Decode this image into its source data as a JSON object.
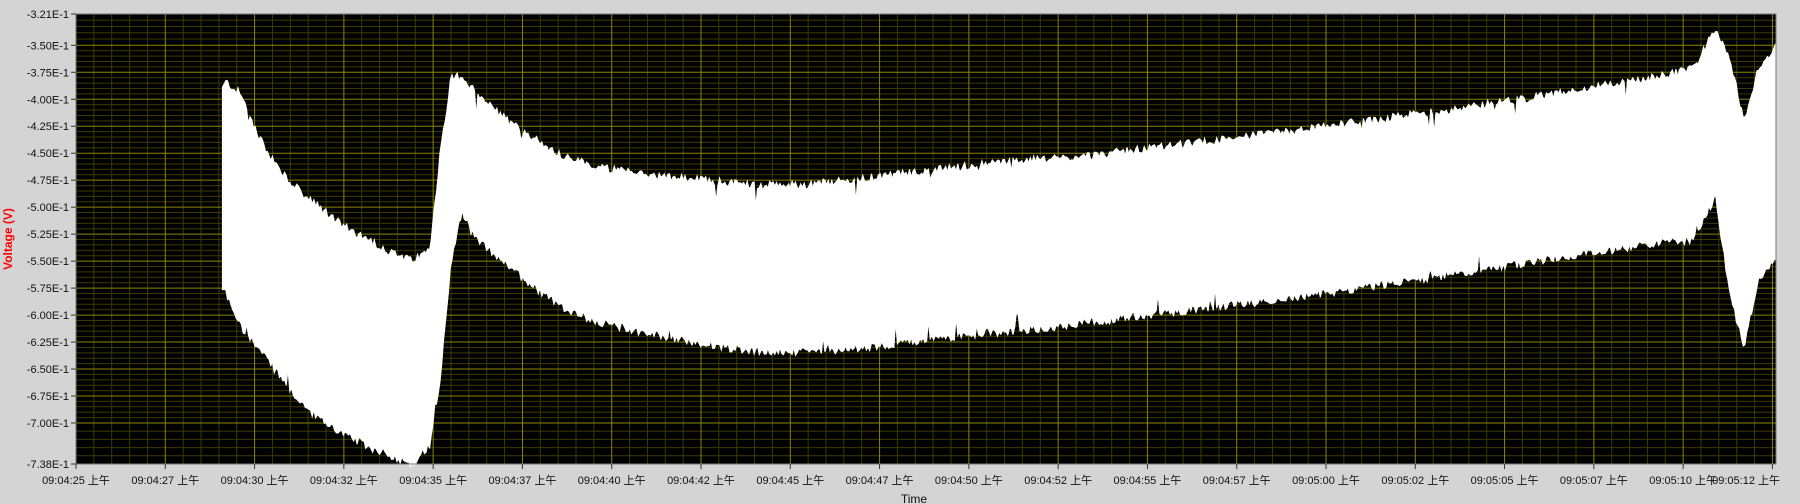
{
  "chart_data": {
    "type": "area",
    "title": "",
    "xlabel": "Time",
    "ylabel": "Voltage (V)",
    "ylim": [
      -0.738,
      -0.321
    ],
    "y_tick_labels": [
      "-3.21E-1",
      "-3.50E-1",
      "-3.75E-1",
      "-4.00E-1",
      "-4.25E-1",
      "-4.50E-1",
      "-4.75E-1",
      "-5.00E-1",
      "-5.25E-1",
      "-5.50E-1",
      "-5.75E-1",
      "-6.00E-1",
      "-6.25E-1",
      "-6.50E-1",
      "-6.75E-1",
      "-7.00E-1",
      "-7.38E-1"
    ],
    "y_tick_values": [
      -0.321,
      -0.35,
      -0.375,
      -0.4,
      -0.425,
      -0.45,
      -0.475,
      -0.5,
      -0.525,
      -0.55,
      -0.575,
      -0.6,
      -0.625,
      -0.65,
      -0.675,
      -0.7,
      -0.738
    ],
    "x_tick_labels": [
      "09:04:25 上午",
      "09:04:27 上午",
      "09:04:30 上午",
      "09:04:32 上午",
      "09:04:35 上午",
      "09:04:37 上午",
      "09:04:40 上午",
      "09:04:42 上午",
      "09:04:45 上午",
      "09:04:47 上午",
      "09:04:50 上午",
      "09:04:52 上午",
      "09:04:55 上午",
      "09:04:57 上午",
      "09:05:00 上午",
      "09:05:02 上午",
      "09:05:05 上午",
      "09:05:07 上午",
      "09:05:10 上午",
      "09:05:12 上午"
    ],
    "x_tick_seconds": [
      25,
      27.5,
      30,
      32.5,
      35,
      37.5,
      40,
      42.5,
      45,
      47.5,
      50,
      52.5,
      55,
      57.5,
      60,
      62.5,
      65,
      67.5,
      70,
      72.5
    ],
    "xlim_seconds": [
      25,
      72.6
    ],
    "grid": true,
    "series": [
      {
        "style": "filled band between upper and lower envelope",
        "x_seconds": [
          29.1,
          29.2,
          29.6,
          30.2,
          30.8,
          31.4,
          32.0,
          32.6,
          33.2,
          33.8,
          34.4,
          34.9,
          35.2,
          35.5,
          35.8,
          36.2,
          36.8,
          37.4,
          38.0,
          38.6,
          39.5,
          40.5,
          41.5,
          42.5,
          43.5,
          44.5,
          45.5,
          46.5,
          47.5,
          48.5,
          49.5,
          50.5,
          51.5,
          52.5,
          53.5,
          54.5,
          55.5,
          56.5,
          57.5,
          58.5,
          59.5,
          60.5,
          61.5,
          62.5,
          63.5,
          64.5,
          65.5,
          66.5,
          67.5,
          68.5,
          69.5,
          70.3,
          70.9,
          71.3,
          71.7,
          72.1,
          72.6
        ],
        "upper": [
          -0.39,
          -0.384,
          -0.395,
          -0.44,
          -0.47,
          -0.49,
          -0.505,
          -0.52,
          -0.53,
          -0.542,
          -0.55,
          -0.54,
          -0.45,
          -0.38,
          -0.378,
          -0.395,
          -0.412,
          -0.428,
          -0.44,
          -0.452,
          -0.462,
          -0.468,
          -0.472,
          -0.475,
          -0.478,
          -0.48,
          -0.479,
          -0.476,
          -0.472,
          -0.468,
          -0.464,
          -0.46,
          -0.457,
          -0.455,
          -0.452,
          -0.448,
          -0.444,
          -0.44,
          -0.436,
          -0.432,
          -0.428,
          -0.423,
          -0.419,
          -0.414,
          -0.41,
          -0.405,
          -0.4,
          -0.395,
          -0.389,
          -0.384,
          -0.378,
          -0.372,
          -0.335,
          -0.36,
          -0.42,
          -0.372,
          -0.352
        ],
        "lower": [
          -0.575,
          -0.58,
          -0.61,
          -0.635,
          -0.66,
          -0.685,
          -0.7,
          -0.712,
          -0.722,
          -0.73,
          -0.738,
          -0.72,
          -0.66,
          -0.55,
          -0.505,
          -0.53,
          -0.545,
          -0.562,
          -0.578,
          -0.592,
          -0.605,
          -0.613,
          -0.62,
          -0.626,
          -0.631,
          -0.634,
          -0.634,
          -0.632,
          -0.628,
          -0.624,
          -0.62,
          -0.617,
          -0.614,
          -0.61,
          -0.606,
          -0.602,
          -0.598,
          -0.594,
          -0.59,
          -0.586,
          -0.582,
          -0.577,
          -0.572,
          -0.567,
          -0.562,
          -0.557,
          -0.552,
          -0.547,
          -0.542,
          -0.537,
          -0.532,
          -0.53,
          -0.49,
          -0.58,
          -0.63,
          -0.57,
          -0.545
        ]
      }
    ]
  }
}
